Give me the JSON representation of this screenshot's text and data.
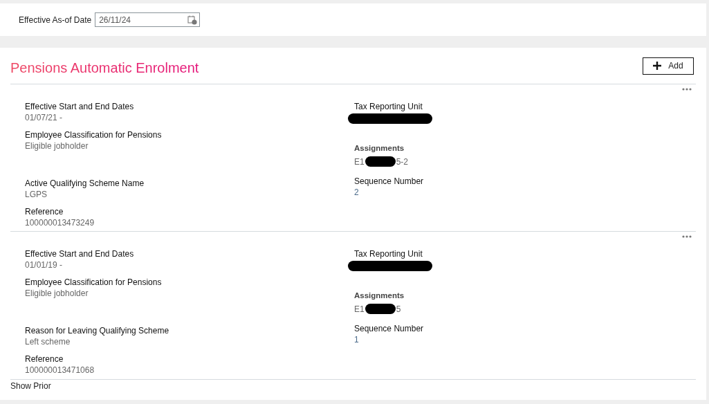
{
  "as_of": {
    "label": "Effective As-of Date",
    "value": "26/11/24"
  },
  "section": {
    "title": "Pensions Automatic Enrolment",
    "add_button": "Add"
  },
  "records": [
    {
      "left": [
        {
          "label": "Effective Start and End Dates",
          "value": "01/07/21 -"
        },
        {
          "label": "Employee Classification for Pensions",
          "value": "Eligible jobholder"
        },
        {
          "label": "Active Qualifying Scheme Name",
          "value": "LGPS"
        },
        {
          "label": "Reference",
          "value": "100000013473249"
        }
      ],
      "right": [
        {
          "label": "Tax Reporting Unit",
          "redacted": true
        },
        {
          "label": "Assignments",
          "value_start": "E1",
          "redacted": true,
          "value_end": "5-2"
        },
        {
          "label": "Sequence Number",
          "value": "2"
        }
      ]
    },
    {
      "left": [
        {
          "label": "Effective Start and End Dates",
          "value": "01/01/19 -"
        },
        {
          "label": "Employee Classification for Pensions",
          "value": "Eligible jobholder"
        },
        {
          "label": "Reason for Leaving Qualifying Scheme",
          "value": "Left scheme"
        },
        {
          "label": "Reference",
          "value": "100000013471068"
        }
      ],
      "right": [
        {
          "label": "Tax Reporting Unit",
          "redacted": true
        },
        {
          "label": "Assignments",
          "value_start": "E1",
          "redacted": true,
          "value_end": "5"
        },
        {
          "label": "Sequence Number",
          "value": "1"
        }
      ]
    }
  ],
  "show_prior": "Show Prior"
}
